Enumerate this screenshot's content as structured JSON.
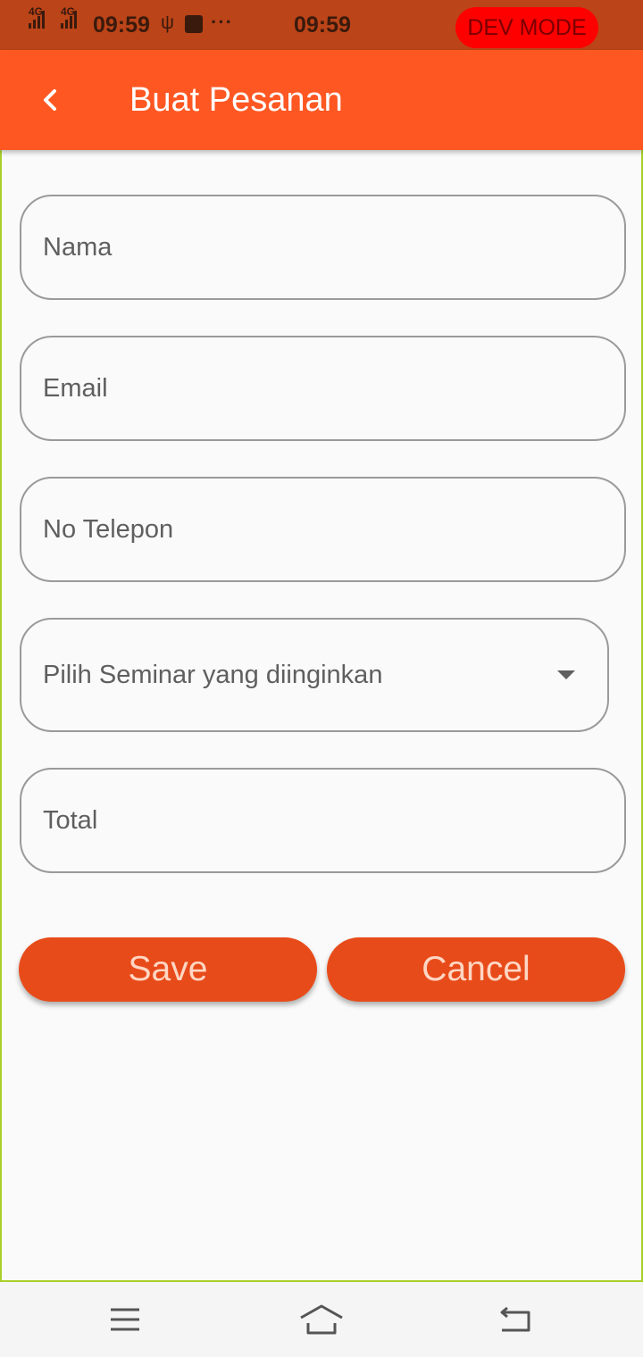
{
  "status_bar": {
    "network_1": "4G",
    "network_2": "4G",
    "time_left": "09:59",
    "usb_symbol": "ψ",
    "overflow": "···",
    "time_center": "09:59",
    "dev_badge": "DEV MODE"
  },
  "app_bar": {
    "title": "Buat Pesanan",
    "background": "#fe5722"
  },
  "form": {
    "name_placeholder": "Nama",
    "email_placeholder": "Email",
    "phone_placeholder": "No Telepon",
    "seminar_placeholder": "Pilih Seminar yang diinginkan",
    "total_placeholder": "Total"
  },
  "actions": {
    "save_label": "Save",
    "cancel_label": "Cancel",
    "button_color": "#e84b1a"
  },
  "nav": {
    "menu_icon": "menu-icon",
    "home_icon": "home-icon",
    "back_icon": "back-icon"
  }
}
